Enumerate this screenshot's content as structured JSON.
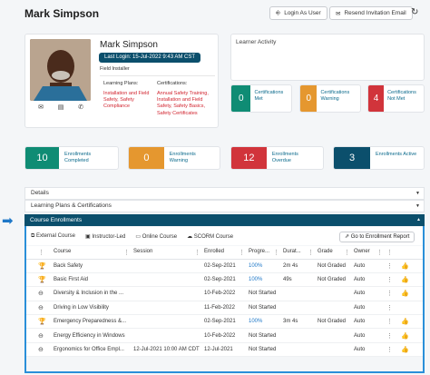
{
  "header": {
    "title": "Mark Simpson",
    "login_as_user": "Login As User",
    "resend_invitation": "Resend Invitation Email"
  },
  "profile": {
    "name": "Mark Simpson",
    "last_login": "Last Login: 15-Jul-2022 9:43 AM CST",
    "role": "Field Installer",
    "learning_plans_label": "Learning Plans:",
    "learning_plans": "Installation and Field Safety, Safety Compliance",
    "certifications_label": "Certifications:",
    "certifications": "Annual Safety Training, Installation and Field Safety, Safety Basics, Safety Certificates"
  },
  "learner_activity": {
    "title": "Learner Activity"
  },
  "cert_stats": [
    {
      "value": "0",
      "label": "Certifications Met",
      "color": "#0f8c74"
    },
    {
      "value": "0",
      "label": "Certifications Warning",
      "color": "#e5972f"
    },
    {
      "value": "4",
      "label": "Certifications Not Met",
      "color": "#d1343b"
    }
  ],
  "enroll_stats": [
    {
      "value": "10",
      "label": "Enrollments Completed",
      "color": "#0f8c74"
    },
    {
      "value": "0",
      "label": "Enrollments Warning",
      "color": "#e5972f"
    },
    {
      "value": "12",
      "label": "Enrollments Overdue",
      "color": "#d1343b"
    },
    {
      "value": "3",
      "label": "Enrollments Active",
      "color": "#0b4f6c"
    }
  ],
  "accordions": {
    "details": "Details",
    "learning_plans": "Learning Plans & Certifications",
    "course_enrollments": "Course Enrollments"
  },
  "toolbar": {
    "external_course": "External Course",
    "instructor_led": "Instructor-Led",
    "online_course": "Online Course",
    "scorm_course": "SCORM Course",
    "go_to_report": "Go to Enrollment Report"
  },
  "table": {
    "columns": [
      "Course",
      "Session",
      "Enrolled",
      "Progre...",
      "Durat...",
      "Grade",
      "Owner"
    ],
    "rows": [
      {
        "icon": "trophy-icon",
        "glyph": "🏆",
        "course": "Back Safety",
        "session": "",
        "enrolled": "02-Sep-2021",
        "progress": "100%",
        "duration": "2m 4s",
        "grade": "Not Graded",
        "owner": "Auto",
        "thumb": true
      },
      {
        "icon": "trophy-icon",
        "glyph": "🏆",
        "course": "Basic First Aid",
        "session": "",
        "enrolled": "02-Sep-2021",
        "progress": "100%",
        "duration": "49s",
        "grade": "Not Graded",
        "owner": "Auto",
        "thumb": true
      },
      {
        "icon": "minus-circle-icon",
        "glyph": "⊖",
        "course": "Diversity & Inclusion in the ...",
        "session": "",
        "enrolled": "10-Feb-2022",
        "progress": "Not Started",
        "duration": "",
        "grade": "",
        "owner": "Auto",
        "thumb": true
      },
      {
        "icon": "minus-circle-icon",
        "glyph": "⊖",
        "course": "Driving in Low Visibility",
        "session": "",
        "enrolled": "11-Feb-2022",
        "progress": "Not Started",
        "duration": "",
        "grade": "",
        "owner": "Auto",
        "thumb": false
      },
      {
        "icon": "trophy-icon",
        "glyph": "🏆",
        "course": "Emergency Preparedness &...",
        "session": "",
        "enrolled": "02-Sep-2021",
        "progress": "100%",
        "duration": "3m 4s",
        "grade": "Not Graded",
        "owner": "Auto",
        "thumb": true
      },
      {
        "icon": "minus-circle-icon",
        "glyph": "⊖",
        "course": "Energy Efficiency in Windows",
        "session": "",
        "enrolled": "10-Feb-2022",
        "progress": "Not Started",
        "duration": "",
        "grade": "",
        "owner": "Auto",
        "thumb": true
      },
      {
        "icon": "minus-circle-icon",
        "glyph": "⊖",
        "course": "Ergonomics for Office Empl...",
        "session": "12-Jul-2021 10:00 AM CDT",
        "enrolled": "12-Jul-2021",
        "progress": "Not Started",
        "duration": "",
        "grade": "",
        "owner": "Auto",
        "thumb": true
      }
    ]
  }
}
